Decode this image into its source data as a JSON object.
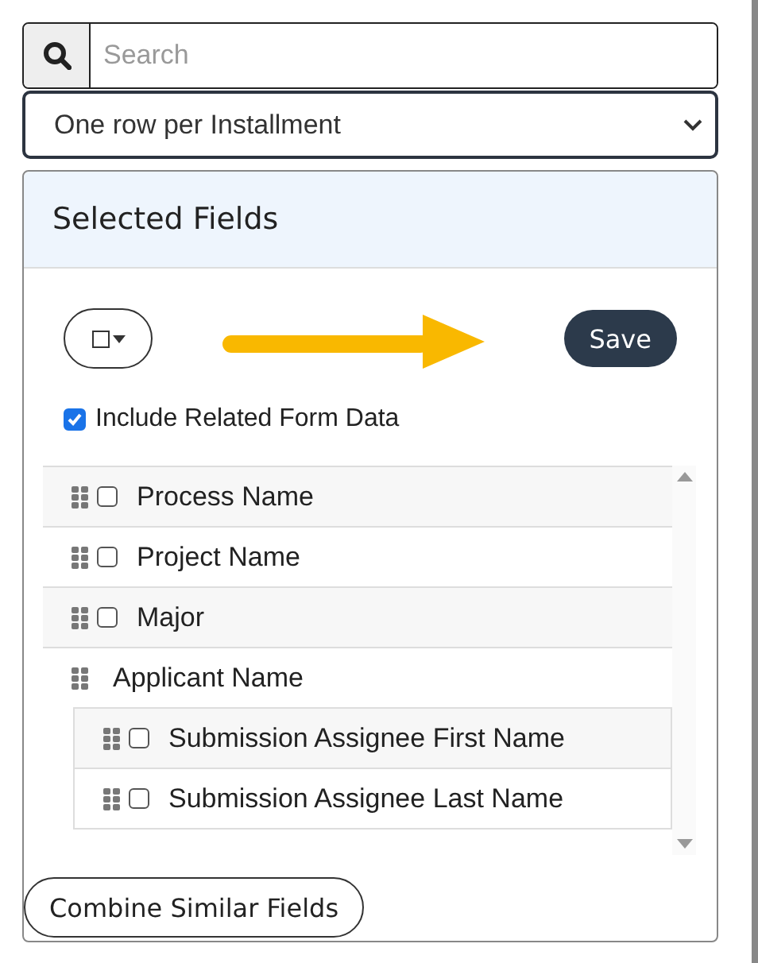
{
  "search": {
    "placeholder": "Search"
  },
  "row_mode": {
    "value": "One row per Installment"
  },
  "panel": {
    "title": "Selected Fields",
    "select_menu": {
      "checked": false
    },
    "save_button": "Save",
    "include_related": {
      "label": "Include Related Form Data",
      "checked": true
    },
    "fields": [
      {
        "kind": "field",
        "label": "Process Name",
        "checked": false
      },
      {
        "kind": "field",
        "label": "Project Name",
        "checked": false
      },
      {
        "kind": "field",
        "label": "Major",
        "checked": false
      },
      {
        "kind": "group",
        "label": "Applicant Name",
        "children": [
          {
            "kind": "field",
            "label": "Submission Assignee First Name",
            "checked": false
          },
          {
            "kind": "field",
            "label": "Submission Assignee Last Name",
            "checked": false
          }
        ]
      }
    ],
    "combine_button": "Combine Similar Fields"
  }
}
